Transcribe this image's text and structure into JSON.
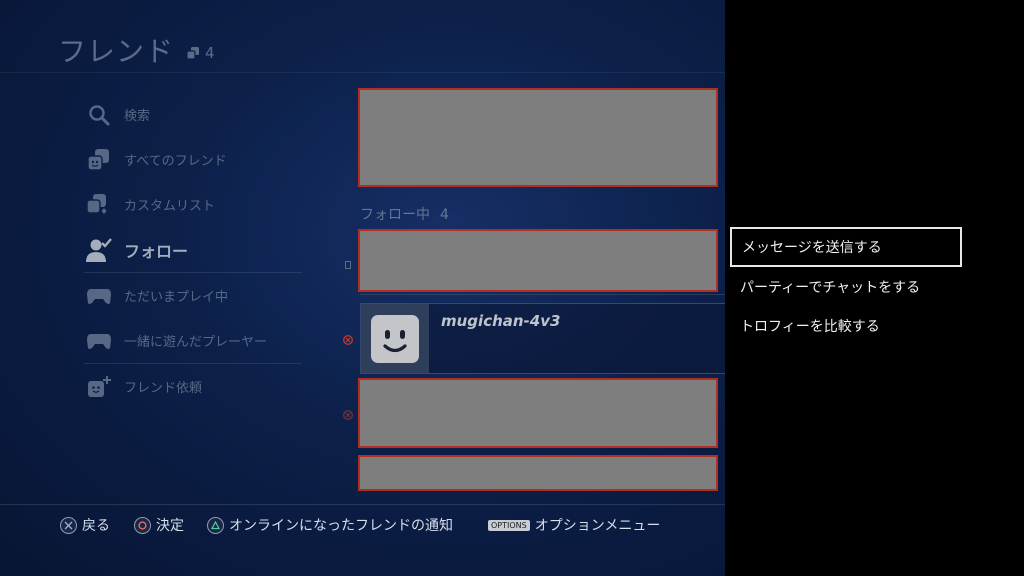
{
  "header": {
    "title": "フレンド",
    "count": "4"
  },
  "sidebar": {
    "items": [
      {
        "label": "検索"
      },
      {
        "label": "すべてのフレンド"
      },
      {
        "label": "カスタムリスト"
      },
      {
        "label": "フォロー"
      },
      {
        "label": "ただいまプレイ中"
      },
      {
        "label": "一緒に遊んだプレーヤー"
      },
      {
        "label": "フレンド依頼"
      }
    ],
    "active_index": 3
  },
  "main": {
    "section_label": "フォロー中",
    "section_count": "4",
    "friend": {
      "name": "mugichan-4v3"
    }
  },
  "footer": {
    "back_label": "戻る",
    "confirm_label": "決定",
    "notify_label": "オンラインになったフレンドの通知",
    "options_button": "OPTIONS",
    "options_label": "オプションメニュー"
  },
  "menu": {
    "items": [
      {
        "label": "メッセージを送信する"
      },
      {
        "label": "パーティーでチャットをする"
      },
      {
        "label": "トロフィーを比較する"
      }
    ],
    "selected_index": 0
  },
  "colors": {
    "accent_red": "#d83a2a",
    "background_blue": "#0f2759",
    "redacted_gray": "#9a9a9a"
  }
}
